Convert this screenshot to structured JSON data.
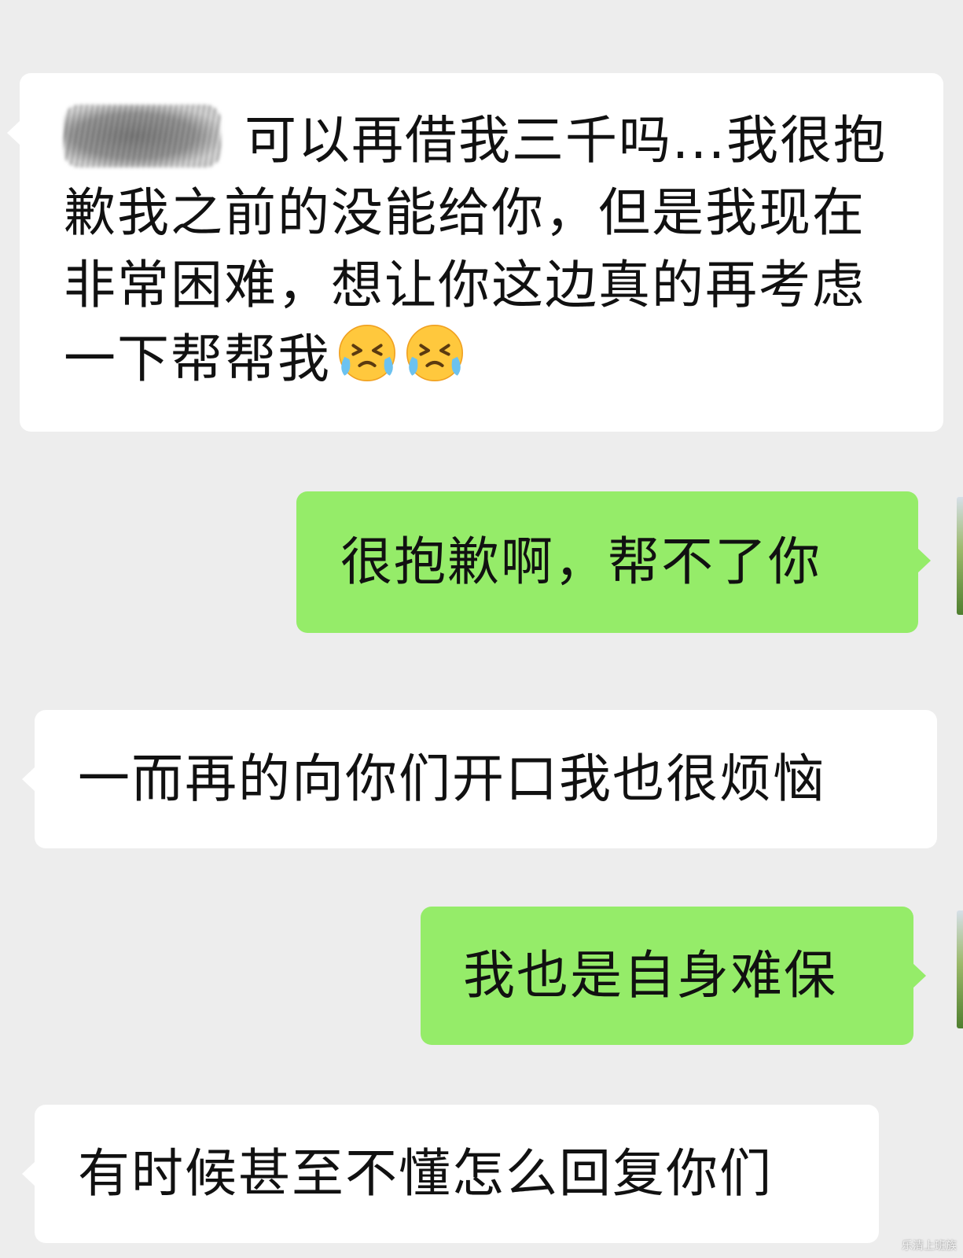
{
  "chat": {
    "messages": [
      {
        "sender": "contact",
        "text": "可以再借我三千吗...我很抱歉我之前的没能给你，但是我现在非常困难，想让你这边真的再考虑一下帮帮我",
        "emoji": [
          "crying-face",
          "crying-face"
        ]
      },
      {
        "sender": "me",
        "text": "很抱歉啊，帮不了你"
      },
      {
        "sender": "contact",
        "text": "一而再的向你们开口我也很烦恼"
      },
      {
        "sender": "me",
        "text": "我也是自身难保"
      },
      {
        "sender": "contact",
        "text": "有时候甚至不懂怎么回复你们"
      }
    ]
  },
  "watermark": {
    "text": "乐清上班族"
  },
  "colors": {
    "background": "#ededed",
    "incoming_bubble": "#ffffff",
    "outgoing_bubble": "#95ec69",
    "text": "#111111"
  }
}
